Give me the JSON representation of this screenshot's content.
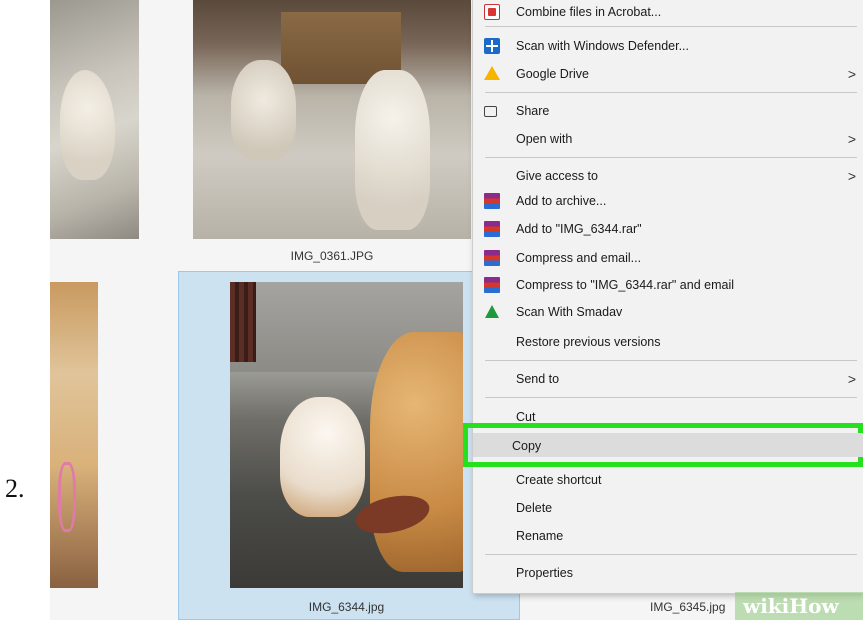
{
  "step_number": "2.",
  "files": [
    {
      "name": ""
    },
    {
      "name": "IMG_0361.JPG"
    },
    {
      "name": ""
    },
    {
      "name": "IMG_6344.jpg",
      "selected": true
    },
    {
      "name": "IMG_6345.jpg"
    }
  ],
  "context_menu": {
    "items": [
      {
        "label": "Combine files in Acrobat...",
        "icon": "acrobat-icon"
      },
      {
        "label": "Scan with Windows Defender...",
        "icon": "windows-defender-icon"
      },
      {
        "label": "Google Drive",
        "icon": "google-drive-icon",
        "submenu": true
      },
      {
        "label": "Share",
        "icon": "share-icon"
      },
      {
        "label": "Open with",
        "icon": "",
        "submenu": true
      },
      {
        "label": "Give access to",
        "icon": "",
        "submenu": true
      },
      {
        "label": "Add to archive...",
        "icon": "winrar-icon"
      },
      {
        "label": "Add to \"IMG_6344.rar\"",
        "icon": "winrar-icon"
      },
      {
        "label": "Compress and email...",
        "icon": "winrar-icon"
      },
      {
        "label": "Compress to \"IMG_6344.rar\" and email",
        "icon": "winrar-icon"
      },
      {
        "label": "Scan With Smadav",
        "icon": "smadav-icon"
      },
      {
        "label": "Restore previous versions",
        "icon": ""
      },
      {
        "label": "Send to",
        "icon": "",
        "submenu": true
      },
      {
        "label": "Cut",
        "icon": ""
      },
      {
        "label": "Copy",
        "icon": "",
        "highlighted": true
      },
      {
        "label": "Create shortcut",
        "icon": ""
      },
      {
        "label": "Delete",
        "icon": ""
      },
      {
        "label": "Rename",
        "icon": ""
      },
      {
        "label": "Properties",
        "icon": ""
      }
    ],
    "submenu_arrow": ">"
  },
  "highlight_color": "#27e01d",
  "watermark": {
    "prefix": "wiki",
    "suffix": "How"
  }
}
